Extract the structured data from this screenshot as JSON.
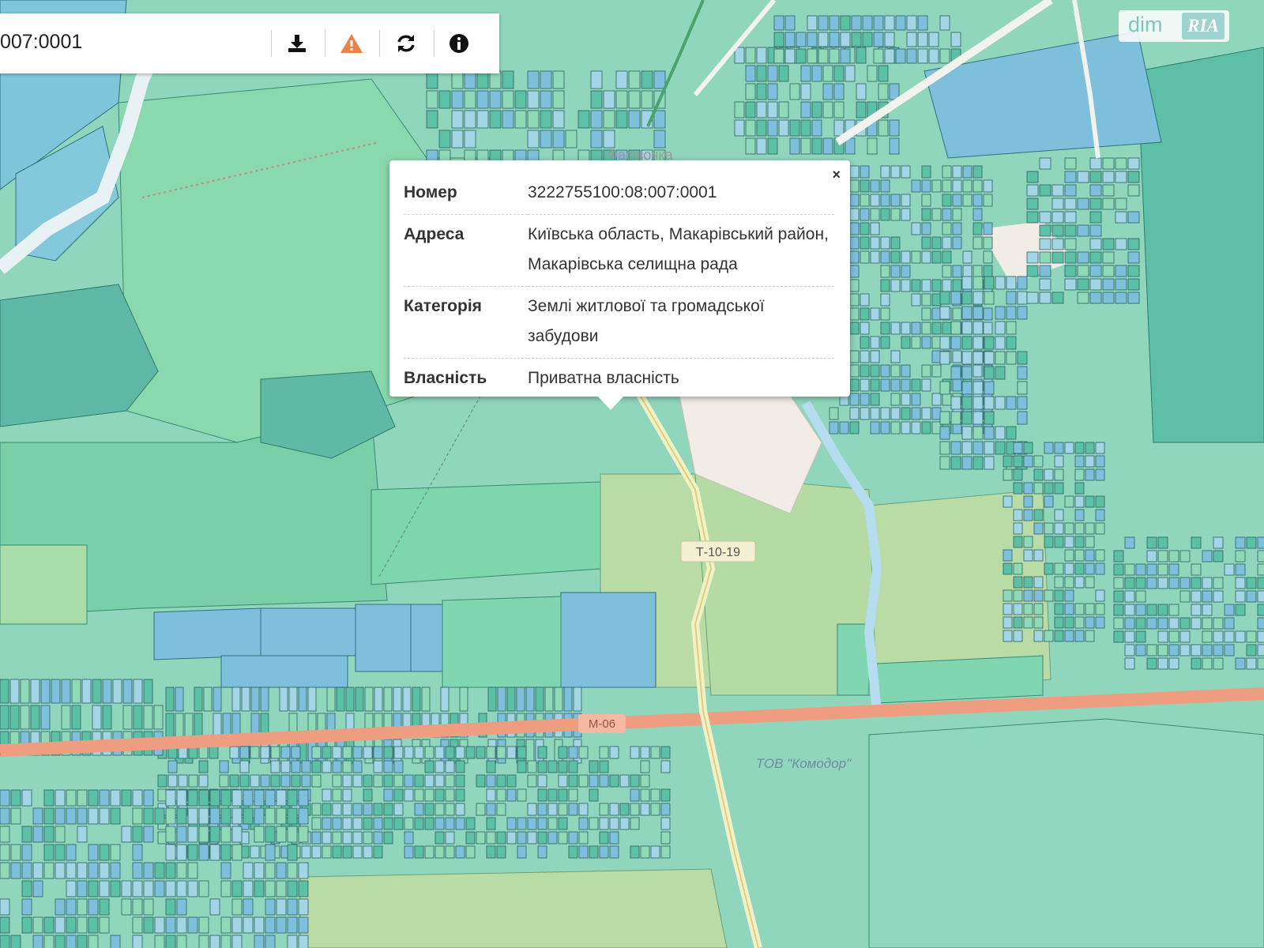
{
  "search": {
    "value": "007:0001"
  },
  "toolbar": {
    "icons": [
      "download-icon",
      "warning-icon",
      "refresh-icon",
      "info-icon"
    ]
  },
  "popup": {
    "close_label": "×",
    "rows": [
      {
        "label": "Номер",
        "value": "3222755100:08:007:0001"
      },
      {
        "label": "Адреса",
        "value": "Київська область, Макарівський район, Макарівська селищна рада"
      },
      {
        "label": "Категорія",
        "value": "Землі житлової та громадської забудови"
      },
      {
        "label": "Власність",
        "value": "Приватна власність"
      }
    ]
  },
  "map": {
    "road_labels": {
      "t_road": "Т-10-19",
      "m_road": "М-06"
    },
    "place_labels": {
      "village": "Фасівочка",
      "company": "ТОВ \"Комодор\""
    },
    "colors": {
      "parcel_green": "#8fd8b8",
      "parcel_blue": "#7ec0dc",
      "parcel_teal": "#5cc0a4",
      "field_olive": "#b9dca6",
      "highway": "#ee9d80",
      "regional_road": "#e9e59a",
      "water": "#b5dcef"
    }
  },
  "logo": {
    "brand_left": "dim",
    "brand_right": "RIA"
  }
}
